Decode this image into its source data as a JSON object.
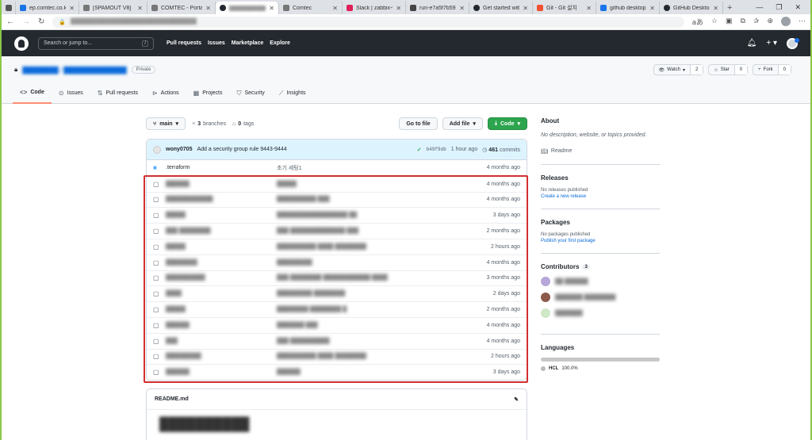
{
  "browser": {
    "tabs": [
      {
        "title": "",
        "color": "#555555"
      },
      {
        "title": "ep.comtec.co.kr",
        "color": "#1a73e8"
      },
      {
        "title": "[SPAMOUT V8]",
        "color": "#777777"
      },
      {
        "title": "COMTEC - Porta",
        "color": "#777777"
      },
      {
        "title": "",
        "color": "#24292f",
        "active": true
      },
      {
        "title": "Comtec",
        "color": "#777777"
      },
      {
        "title": "Slack | zabbix-w",
        "color": "#e01e5a"
      },
      {
        "title": "run-e7a5f7b59",
        "color": "#444444"
      },
      {
        "title": "Get started with",
        "color": "#24292f"
      },
      {
        "title": "Git - Git 설치",
        "color": "#f05133"
      },
      {
        "title": "github desktop",
        "color": "#1a73e8"
      },
      {
        "title": "GitHub Desktop",
        "color": "#24292f"
      }
    ]
  },
  "gh": {
    "search_placeholder": "Search or jump to...",
    "search_key": "/",
    "nav": [
      "Pull requests",
      "Issues",
      "Marketplace",
      "Explore"
    ]
  },
  "repo": {
    "private_label": "Private",
    "watch_label": "Watch",
    "watch_count": "2",
    "star_label": "Star",
    "star_count": "0",
    "fork_label": "Fork",
    "fork_count": "0",
    "tabs": [
      "Code",
      "Issues",
      "Pull requests",
      "Actions",
      "Projects",
      "Security",
      "Insights"
    ]
  },
  "toolbar": {
    "branch": "main",
    "branches_count": "3",
    "branches_label": "branches",
    "tags_count": "0",
    "tags_label": "tags",
    "goto_file": "Go to file",
    "add_file": "Add file",
    "code": "Code"
  },
  "commit": {
    "user": "wony0705",
    "message": "Add a security group rule 9443-9444",
    "sha": "b49f9db",
    "time": "1 hour ago",
    "commits_count": "461",
    "commits_label": "commits"
  },
  "files": [
    {
      "name": ".terraform",
      "message": "초기 세팅1",
      "time": "4 months ago",
      "dir": true
    },
    {
      "name": "",
      "message": "",
      "time": "4 months ago"
    },
    {
      "name": "",
      "message": "",
      "time": "4 months ago"
    },
    {
      "name": "",
      "message": "",
      "time": "3 days ago"
    },
    {
      "name": "",
      "message": "",
      "time": "2 months ago"
    },
    {
      "name": "",
      "message": "",
      "time": "2 hours ago"
    },
    {
      "name": "",
      "message": "",
      "time": "4 months ago"
    },
    {
      "name": "",
      "message": "",
      "time": "3 months ago"
    },
    {
      "name": "",
      "message": "",
      "time": "2 days ago"
    },
    {
      "name": "",
      "message": "",
      "time": "2 months ago"
    },
    {
      "name": "",
      "message": "",
      "time": "4 months ago"
    },
    {
      "name": "",
      "message": "",
      "time": "4 months ago"
    },
    {
      "name": "",
      "message": "",
      "time": "2 hours ago"
    },
    {
      "name": "",
      "message": "",
      "time": "3 days ago"
    }
  ],
  "readme": {
    "filename": "README.md"
  },
  "sidebar": {
    "about_title": "About",
    "about_desc": "No description, website, or topics provided.",
    "readme_link": "Readme",
    "releases_title": "Releases",
    "releases_none": "No releases published",
    "releases_link": "Create a new release",
    "packages_title": "Packages",
    "packages_none": "No packages published",
    "packages_link": "Publish your first package",
    "contributors_title": "Contributors",
    "contributors_count": "3",
    "languages_title": "Languages",
    "lang_name": "HCL",
    "lang_pct": "100.0%"
  }
}
